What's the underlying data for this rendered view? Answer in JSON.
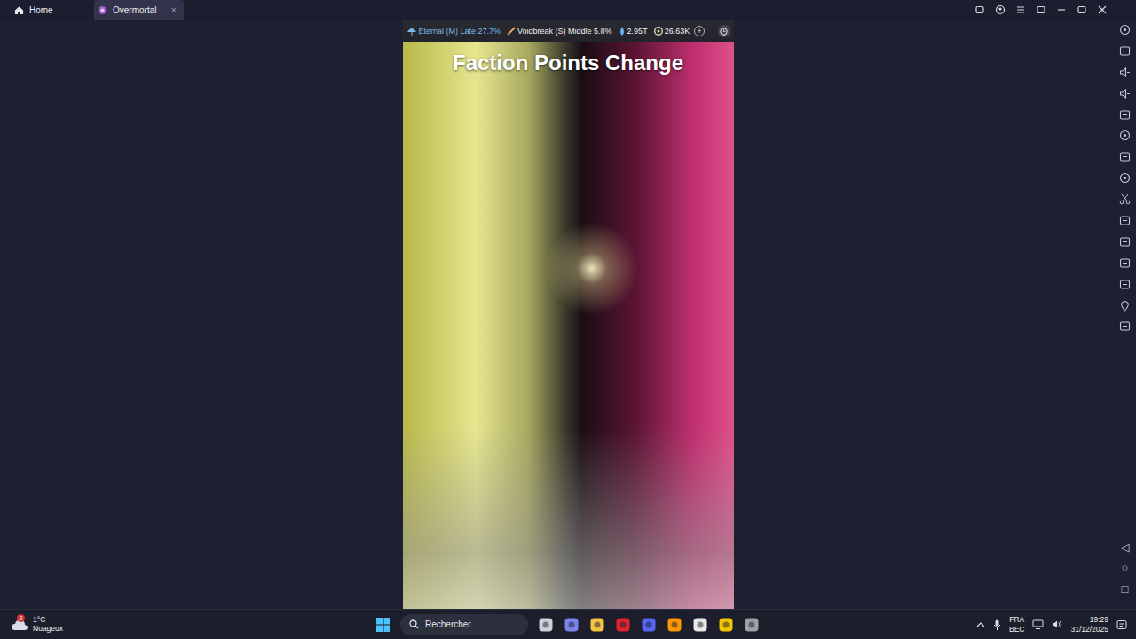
{
  "window": {
    "tabs": [
      {
        "label": "Home",
        "selected": false,
        "close": ""
      },
      {
        "label": "Overmortal",
        "selected": true,
        "close": "×"
      }
    ]
  },
  "game": {
    "status_bar": {
      "realm": "Eternal (M) Late 27.7%",
      "weapon": "Voidbreak (S) Middle 5.8%",
      "essence": "2.95T",
      "spirit_stones": "26.63K",
      "add": "+"
    },
    "title": "Faction Points Change"
  },
  "android_nav": [
    "◁",
    "○",
    "□"
  ],
  "taskbar": {
    "weather": {
      "temperature": "1°C",
      "condition": "Nuageux",
      "badge": "2"
    },
    "search": {
      "placeholder": "Rechercher"
    },
    "tray": {
      "language": "FRA",
      "layout": "BEC"
    },
    "clock": {
      "time": "19:29",
      "date": "31/12/2025"
    }
  }
}
